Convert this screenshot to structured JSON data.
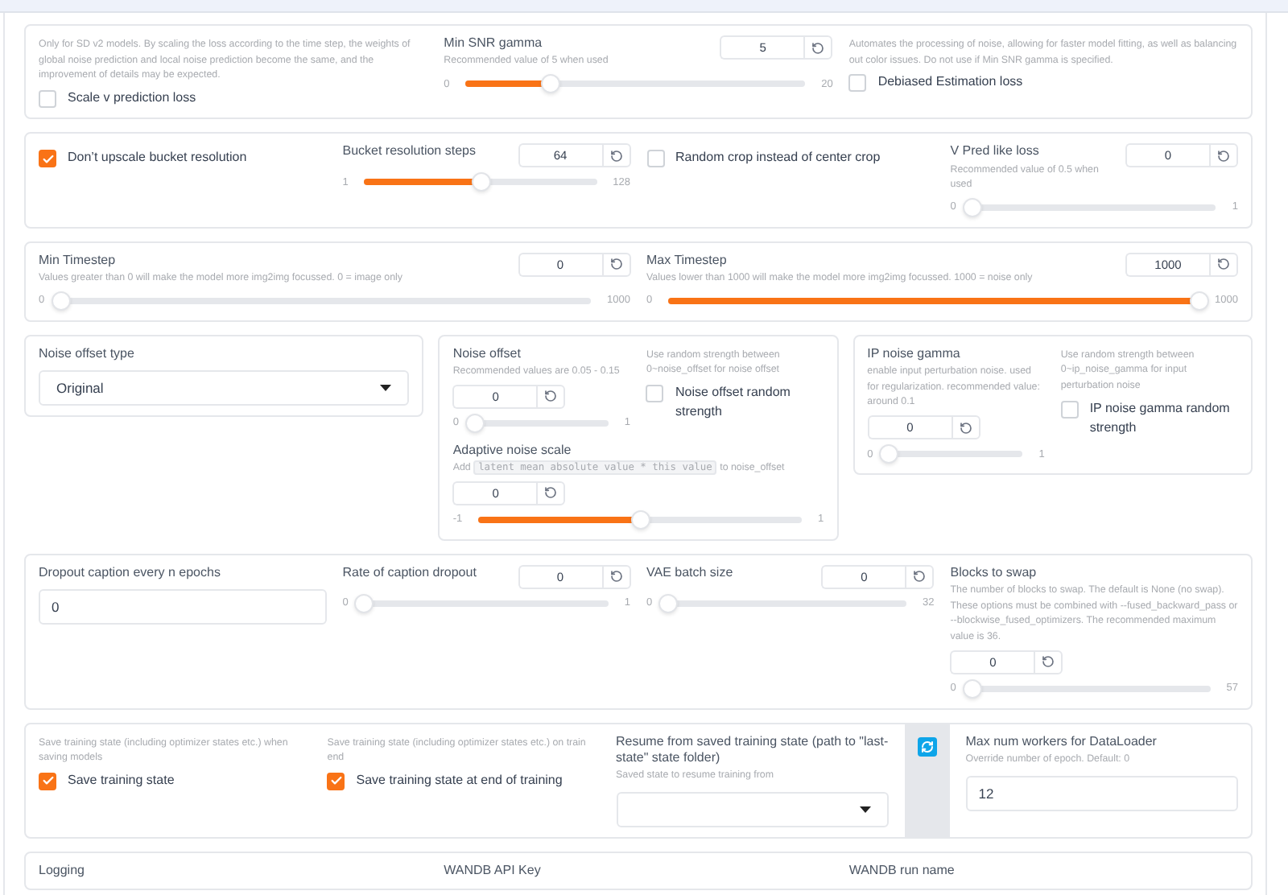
{
  "sections": [
    {
      "kind": "panel",
      "columns": [
        {
          "items": [
            {
              "kind": "checkbox",
              "info": "Only for SD v2 models. By scaling the loss according to the time step, the weights of global noise prediction and local noise prediction become the same, and the improvement of details may be expected.",
              "label": "Scale v prediction loss",
              "checked": false
            }
          ]
        },
        {
          "items": [
            {
              "kind": "slider",
              "label": "Min SNR gamma",
              "info": "Recommended value of 5 when used",
              "value": "5",
              "min": "0",
              "max": "20",
              "level": 0.25
            }
          ]
        },
        {
          "items": [
            {
              "kind": "checkbox",
              "info": "Automates the processing of noise, allowing for faster model fitting, as well as balancing out color issues. Do not use if Min SNR gamma is specified.",
              "label": "Debiased Estimation loss",
              "checked": false
            }
          ]
        }
      ]
    },
    {
      "kind": "panel",
      "columns": [
        {
          "items": [
            {
              "kind": "checkbox",
              "label": "Don’t upscale bucket resolution",
              "checked": true
            }
          ]
        },
        {
          "items": [
            {
              "kind": "slider",
              "label": "Bucket resolution steps",
              "value": "64",
              "min": "1",
              "max": "128",
              "level": 0.5
            }
          ]
        },
        {
          "items": [
            {
              "kind": "checkbox",
              "label": "Random crop instead of center crop",
              "checked": false
            }
          ]
        },
        {
          "items": [
            {
              "kind": "slider",
              "label": "V Pred like loss",
              "info": "Recommended value of 0.5 when used",
              "value": "0",
              "min": "0",
              "max": "1",
              "level": 0
            }
          ]
        }
      ]
    },
    {
      "kind": "panel",
      "columns": [
        {
          "items": [
            {
              "kind": "slider",
              "label": "Min Timestep",
              "info": "Values greater than 0 will make the model more img2img focussed. 0 = image only",
              "value": "0",
              "min": "0",
              "max": "1000",
              "level": 0
            }
          ]
        },
        {
          "items": [
            {
              "kind": "slider",
              "label": "Max Timestep",
              "info": "Values lower than 1000 will make the model more img2img focussed. 1000 = noise only",
              "value": "1000",
              "min": "0",
              "max": "1000",
              "level": 1
            }
          ]
        }
      ]
    },
    {
      "kind": "boxes",
      "columns": [
        {
          "groups": [
            {
              "items": [
                {
                  "kind": "dropdown",
                  "label": "Noise offset type",
                  "value": "Original"
                }
              ]
            }
          ]
        },
        {
          "groups": [
            {
              "items": [
                {
                  "kind": "slider",
                  "label": "Noise offset",
                  "info": "Recommended values are 0.05 - 0.15",
                  "value": "0",
                  "min": "0",
                  "max": "1",
                  "level": 0
                }
              ]
            },
            {
              "items": [
                {
                  "kind": "checkbox",
                  "info": "Use random strength between 0~noise_offset for noise offset",
                  "label": "Noise offset random strength",
                  "checked": false
                }
              ]
            }
          ],
          "footer": {
            "items": [
              {
                "kind": "slider",
                "label": "Adaptive noise scale",
                "info": "Add",
                "info_code": "latent mean absolute value * this value",
                "info_after": "to noise_offset",
                "value": "0",
                "min": "-1",
                "max": "1",
                "level": 0.5
              }
            ]
          }
        },
        {
          "groups": [
            {
              "items": [
                {
                  "kind": "slider",
                  "label": "IP noise gamma",
                  "info": "enable input perturbation noise. used for regularization. recommended value: around 0.1",
                  "value": "0",
                  "min": "0",
                  "max": "1",
                  "level": 0
                }
              ]
            },
            {
              "items": [
                {
                  "kind": "checkbox",
                  "info": "Use random strength between 0~ip_noise_gamma for input perturbation noise",
                  "label": "IP noise gamma random strength",
                  "checked": false
                }
              ]
            }
          ]
        }
      ]
    },
    {
      "kind": "panel",
      "columns": [
        {
          "items": [
            {
              "kind": "textbox",
              "label": "Dropout caption every n epochs",
              "value": "0"
            }
          ]
        },
        {
          "items": [
            {
              "kind": "slider",
              "label": "Rate of caption dropout",
              "value": "0",
              "min": "0",
              "max": "1",
              "level": 0
            }
          ]
        },
        {
          "items": [
            {
              "kind": "slider",
              "label": "VAE batch size",
              "value": "0",
              "min": "0",
              "max": "32",
              "level": 0
            }
          ]
        },
        {
          "items": [
            {
              "kind": "slider",
              "label": "Blocks to swap",
              "info": "The number of blocks to swap. The default is None (no swap). These options must be combined with --fused_backward_pass or --blockwise_fused_optimizers. The recommended maximum value is 36.",
              "value": "0",
              "min": "0",
              "max": "57",
              "level": 0
            }
          ]
        }
      ]
    },
    {
      "kind": "panel",
      "columns": [
        {
          "items": [
            {
              "kind": "checkbox",
              "info": "Save training state (including optimizer states etc.) when saving models",
              "label": "Save training state",
              "checked": true
            }
          ]
        },
        {
          "items": [
            {
              "kind": "checkbox",
              "info": "Save training state (including optimizer states etc.) on train end",
              "label": "Save training state at end of training",
              "checked": true
            }
          ]
        },
        {
          "items": [
            {
              "kind": "dropdown",
              "label": "Resume from saved training state (path to \"last-state\" state folder)",
              "info": "Saved state to resume training from"
            }
          ]
        },
        {
          "items": [
            {
              "kind": "refresh"
            }
          ]
        },
        {
          "items": [
            {
              "kind": "textbox",
              "label": "Max num workers for DataLoader",
              "info": "Override number of epoch. Default: 0",
              "value": "12"
            }
          ]
        }
      ]
    },
    {
      "kind": "panel",
      "columns": [
        {
          "items": [
            {
              "kind": "label",
              "label": "Logging"
            }
          ]
        },
        {
          "items": [
            {
              "kind": "label",
              "label": "WANDB API Key"
            }
          ]
        },
        {
          "items": [
            {
              "kind": "label",
              "label": "WANDB run name"
            }
          ]
        }
      ]
    }
  ]
}
